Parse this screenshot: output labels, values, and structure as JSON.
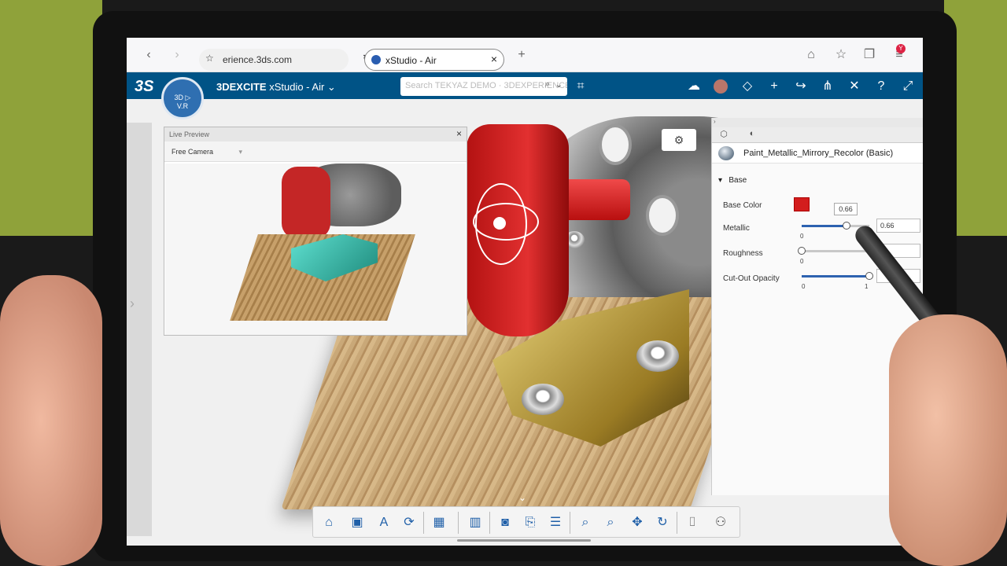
{
  "browser": {
    "url": "erience.3ds.com",
    "tab_title": "xStudio - Air",
    "profile_initial": "Y"
  },
  "app": {
    "brand": "3DEXCITE",
    "product": "xStudio - Air",
    "search_placeholder": "Search TEKYAZ DEMO · 3DEXPERIENCE",
    "compass_label": "3D",
    "compass_sub": "V.R"
  },
  "live_preview": {
    "title": "Live Preview",
    "camera": "Free Camera"
  },
  "panel": {
    "material_name": "Paint_Metallic_Mirrory_Recolor (Basic)",
    "section": "Base",
    "base_color_label": "Base Color",
    "base_color": "#d31d1d",
    "metallic_label": "Metallic",
    "metallic_value": "0.66",
    "metallic_fraction": 0.66,
    "metallic_tooltip": "0.66",
    "metallic_min": "0",
    "roughness_label": "Roughness",
    "roughness_fraction": 0,
    "roughness_min": "0",
    "cutout_label": "Cut-Out Opacity",
    "cutout_fraction": 1,
    "cutout_min": "0",
    "cutout_max": "1"
  },
  "colors": {
    "appbar": "#005386",
    "toolbar_icon": "#1f5fa8"
  },
  "toolbar": {
    "icons": [
      "home-icon",
      "save-icon",
      "text-style-icon",
      "refresh-icon",
      "image-icon",
      "picture-icon",
      "render-icon",
      "camera-switch-icon",
      "list-icon",
      "zoom-fit-icon",
      "zoom-icon",
      "move-icon",
      "rotate-icon",
      "snapshot-icon",
      "vr-icon"
    ]
  }
}
